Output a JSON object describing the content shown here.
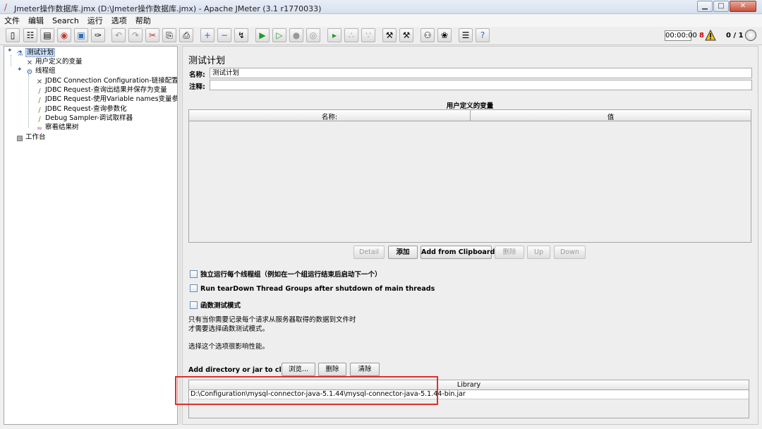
{
  "window": {
    "title": "Jmeter操作数据库.jmx (D:\\Jmeter操作数据库.jmx) - Apache JMeter (3.1 r1770033)"
  },
  "menu": [
    "文件",
    "编辑",
    "Search",
    "运行",
    "选项",
    "帮助"
  ],
  "toolbar": {
    "timer": "00:00:00",
    "error_count": "8",
    "threads": "0 / 1"
  },
  "tree": {
    "items": [
      {
        "label": "测试计划",
        "icon": "flask-icon"
      },
      {
        "label": "用户定义的变量",
        "icon": "wrench-icon"
      },
      {
        "label": "线程组",
        "icon": "gear-icon"
      },
      {
        "label": "JDBC Connection Configuration-链接配置",
        "icon": "wrench-icon"
      },
      {
        "label": "JDBC Request-查询出结果并保存为变量",
        "icon": "pipette-icon"
      },
      {
        "label": "JDBC Request-使用Variable names变量参数",
        "icon": "pipette-icon"
      },
      {
        "label": "JDBC Request-查询参数化",
        "icon": "pipette-icon"
      },
      {
        "label": "Debug Sampler-调试取样器",
        "icon": "pipette-icon"
      },
      {
        "label": "察看结果树",
        "icon": "chart-icon"
      },
      {
        "label": "工作台",
        "icon": "workbench-icon"
      }
    ]
  },
  "plan": {
    "title": "测试计划",
    "name_label": "名称:",
    "name_value": "测试计划",
    "comment_label": "注释:",
    "comment_value": ""
  },
  "variables": {
    "caption": "用户定义的变量",
    "col_name": "名称:",
    "col_value": "值"
  },
  "var_buttons": {
    "detail": "Detail",
    "add": "添加",
    "add_clipboard": "Add from Clipboard",
    "delete": "删除",
    "up": "Up",
    "down": "Down"
  },
  "options": {
    "serialize": "独立运行每个线程组（例如在一个组运行结束后启动下一个）",
    "teardown": "Run tearDown Thread Groups after shutdown of main threads",
    "functional": "函数测试模式",
    "note_line1": "只有当你需要记录每个请求从服务器取得的数据到文件时",
    "note_line2": "才需要选择函数测试模式。",
    "note_line3": "选择这个选项很影响性能。"
  },
  "classpath": {
    "label": "Add directory or jar to classpath",
    "browse": "浏览...",
    "delete": "删除",
    "clear": "清除",
    "column": "Library",
    "rows": [
      "D:\\Configuration\\mysql-connector-java-5.1.44\\mysql-connector-java-5.1.44-bin.jar"
    ]
  }
}
